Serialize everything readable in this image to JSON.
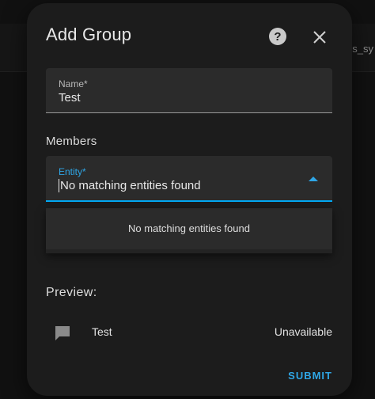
{
  "background": {
    "partial_text": "s_sy"
  },
  "dialog": {
    "title": "Add Group",
    "help_icon": "help-circle-icon",
    "close_icon": "close-icon",
    "name_field": {
      "label": "Name*",
      "value": "Test"
    },
    "members_heading": "Members",
    "entity_field": {
      "label": "Entity*",
      "value": "No matching entities found"
    },
    "dropdown": {
      "message": "No matching entities found"
    },
    "preview": {
      "heading": "Preview:",
      "icon": "comment-icon",
      "name": "Test",
      "state": "Unavailable"
    },
    "submit_label": "SUBMIT"
  },
  "colors": {
    "accent": "#03a9f4",
    "dialog_bg": "#1c1c1c",
    "field_bg": "#2b2b2b"
  }
}
